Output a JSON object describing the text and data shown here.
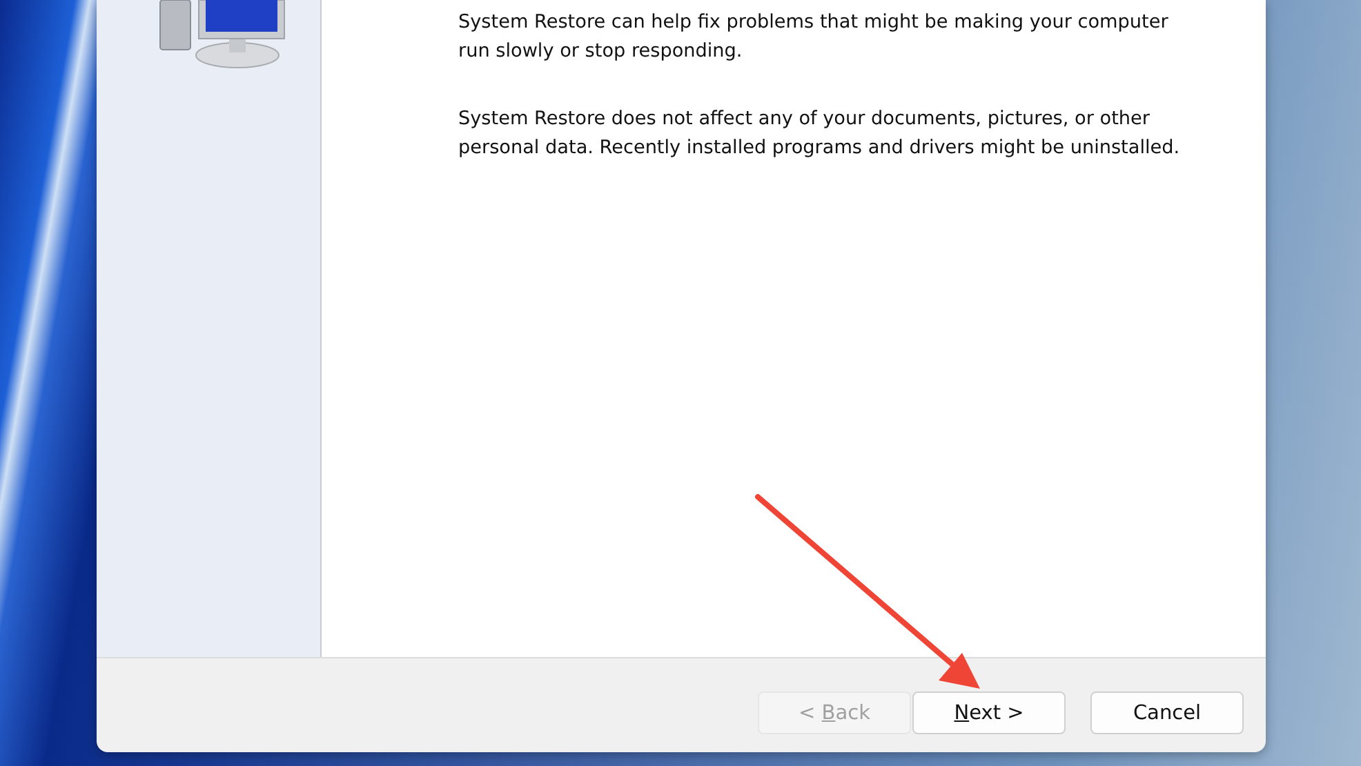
{
  "dialog": {
    "paragraphs": [
      "System Restore can help fix problems that might be making your computer run slowly or stop responding.",
      "System Restore does not affect any of your documents, pictures, or other personal data. Recently installed programs and drivers might be uninstalled."
    ],
    "buttons": [
      {
        "kind": "back",
        "prefix": "< ",
        "mnemonic": "B",
        "rest": "ack",
        "disabled": true
      },
      {
        "kind": "next",
        "mnemonic": "N",
        "rest": "ext >",
        "disabled": false
      },
      {
        "kind": "cancel",
        "prefix": "Cancel",
        "disabled": false
      }
    ]
  }
}
